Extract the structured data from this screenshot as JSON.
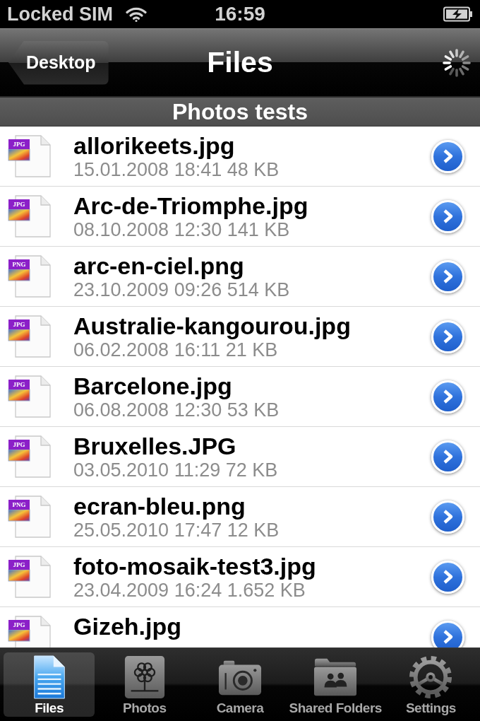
{
  "status_bar": {
    "carrier": "Locked SIM",
    "time": "16:59"
  },
  "nav_bar": {
    "back_button": "Desktop",
    "title": "Files",
    "busy": true
  },
  "section_header": "Photos tests",
  "files": [
    {
      "name": "allorikeets.jpg",
      "details": "15.01.2008 18:41 48 KB",
      "type": "JPG"
    },
    {
      "name": "Arc-de-Triomphe.jpg",
      "details": "08.10.2008 12:30 141 KB",
      "type": "JPG"
    },
    {
      "name": "arc-en-ciel.png",
      "details": "23.10.2009 09:26 514 KB",
      "type": "PNG"
    },
    {
      "name": "Australie-kangourou.jpg",
      "details": "06.02.2008 16:11 21 KB",
      "type": "JPG"
    },
    {
      "name": "Barcelone.jpg",
      "details": "06.08.2008 12:30 53 KB",
      "type": "JPG"
    },
    {
      "name": "Bruxelles.JPG",
      "details": "03.05.2010 11:29 72 KB",
      "type": "JPG"
    },
    {
      "name": "ecran-bleu.png",
      "details": "25.05.2010 17:47 12 KB",
      "type": "PNG"
    },
    {
      "name": "foto-mosaik-test3.jpg",
      "details": "23.04.2009 16:24 1.652 KB",
      "type": "JPG"
    },
    {
      "name": "Gizeh.jpg",
      "type": "JPG"
    }
  ],
  "tab_bar": [
    {
      "label": "Files",
      "kind": "document",
      "selected": true
    },
    {
      "label": "Photos",
      "kind": "flower",
      "selected": false
    },
    {
      "label": "Camera",
      "kind": "camera",
      "selected": false
    },
    {
      "label": "Shared Folders",
      "kind": "folder",
      "selected": false
    },
    {
      "label": "Settings",
      "kind": "gear",
      "selected": false
    }
  ]
}
